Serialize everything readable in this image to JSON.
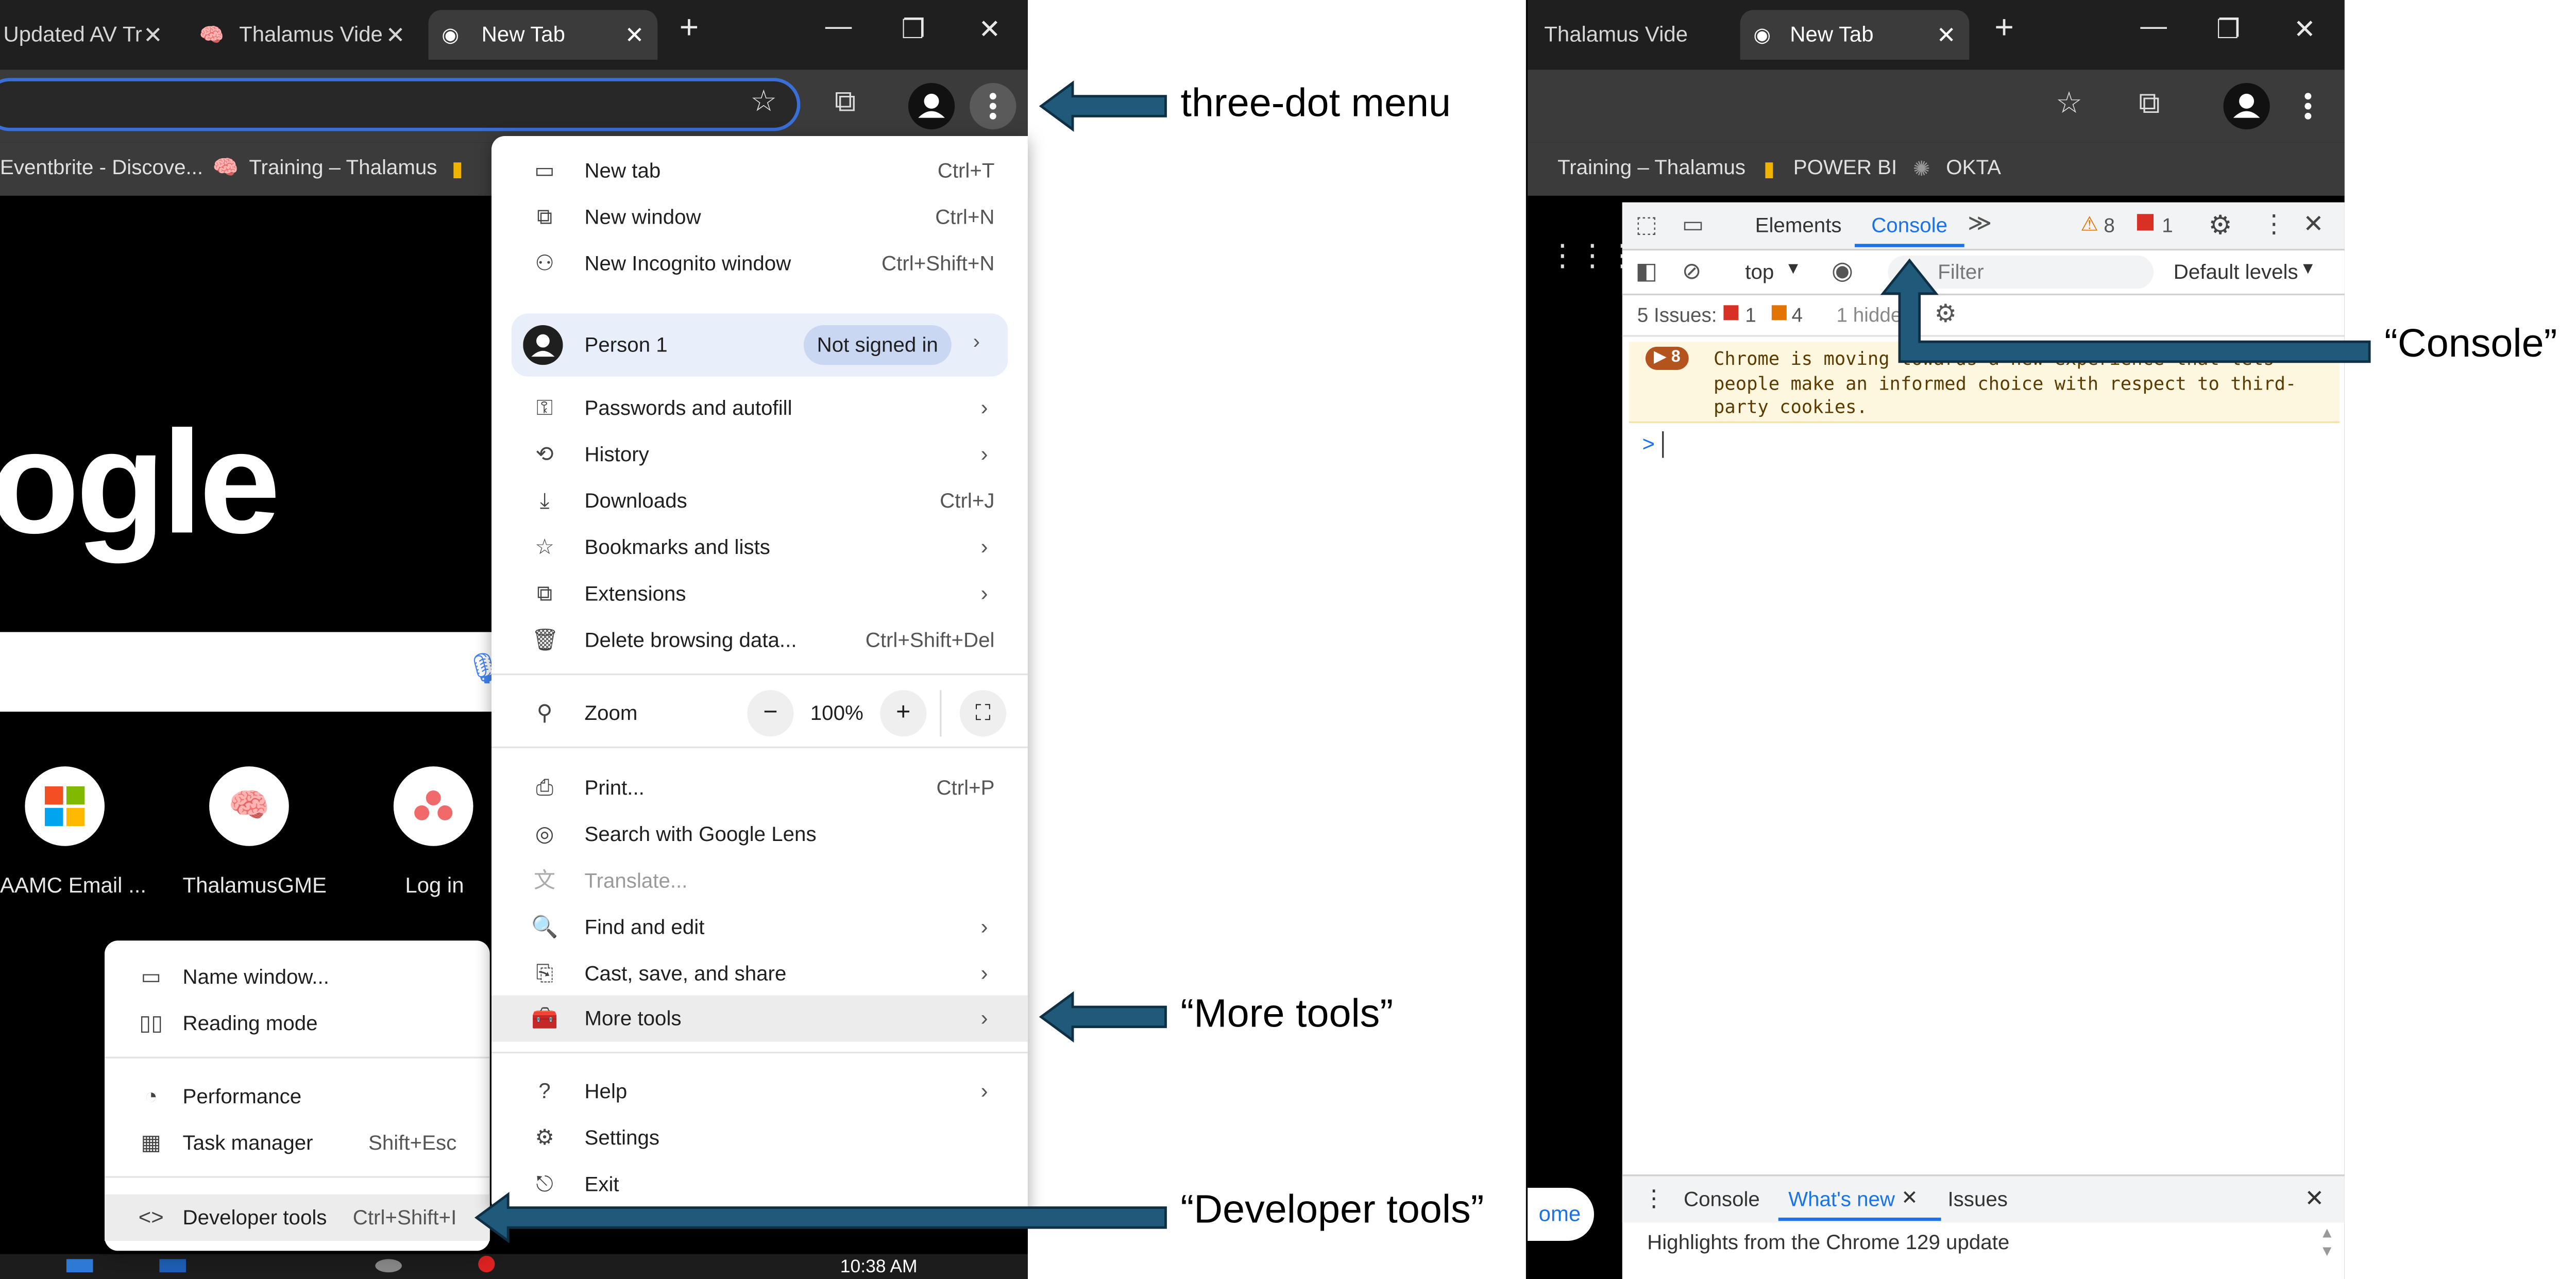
{
  "left_browser": {
    "tabs": [
      {
        "label": "Updated AV Tr",
        "icon": "globe-icon"
      },
      {
        "label": "Thalamus Vide",
        "icon": "brain-icon"
      },
      {
        "label": "New Tab",
        "icon": "chrome-icon",
        "active": true
      }
    ],
    "bookmarks": [
      "Eventbrite - Discove...",
      "Training – Thalamus"
    ],
    "logo_text": "ogle",
    "shortcuts": [
      {
        "label": "AAMC Email ...",
        "icon": "microsoft-icon"
      },
      {
        "label": "ThalamusGME",
        "icon": "brain-icon"
      },
      {
        "label": "Log in",
        "icon": "asana-icon"
      }
    ],
    "taskbar_time": "10:38 AM"
  },
  "chrome_menu": {
    "group1": [
      {
        "label": "New tab",
        "shortcut": "Ctrl+T",
        "icon": "new-tab-icon"
      },
      {
        "label": "New window",
        "shortcut": "Ctrl+N",
        "icon": "new-window-icon"
      },
      {
        "label": "New Incognito window",
        "shortcut": "Ctrl+Shift+N",
        "icon": "incognito-icon"
      }
    ],
    "profile": {
      "name": "Person 1",
      "status": "Not signed in"
    },
    "group2": [
      {
        "label": "Passwords and autofill",
        "icon": "key-icon",
        "arrow": true
      },
      {
        "label": "History",
        "icon": "history-icon",
        "arrow": true
      },
      {
        "label": "Downloads",
        "shortcut": "Ctrl+J",
        "icon": "download-icon"
      },
      {
        "label": "Bookmarks and lists",
        "icon": "star-icon",
        "arrow": true
      },
      {
        "label": "Extensions",
        "icon": "puzzle-icon",
        "arrow": true
      },
      {
        "label": "Delete browsing data...",
        "shortcut": "Ctrl+Shift+Del",
        "icon": "trash-icon"
      }
    ],
    "zoom": {
      "label": "Zoom",
      "value": "100%",
      "minus": "−",
      "plus": "+"
    },
    "group3": [
      {
        "label": "Print...",
        "shortcut": "Ctrl+P",
        "icon": "print-icon"
      },
      {
        "label": "Search with Google Lens",
        "icon": "lens-icon"
      },
      {
        "label": "Translate...",
        "icon": "translate-icon",
        "disabled": true
      },
      {
        "label": "Find and edit",
        "icon": "find-icon",
        "arrow": true
      },
      {
        "label": "Cast, save, and share",
        "icon": "cast-icon",
        "arrow": true
      },
      {
        "label": "More tools",
        "icon": "toolbox-icon",
        "arrow": true,
        "highlight": true
      }
    ],
    "group4": [
      {
        "label": "Help",
        "icon": "help-icon",
        "arrow": true
      },
      {
        "label": "Settings",
        "icon": "gear-icon"
      },
      {
        "label": "Exit",
        "icon": "exit-icon"
      }
    ]
  },
  "more_tools_menu": {
    "group1": [
      {
        "label": "Name window...",
        "icon": "window-icon"
      },
      {
        "label": "Reading mode",
        "icon": "book-icon"
      }
    ],
    "group2": [
      {
        "label": "Performance",
        "icon": "gauge-icon"
      },
      {
        "label": "Task manager",
        "shortcut": "Shift+Esc",
        "icon": "table-icon"
      }
    ],
    "group3": [
      {
        "label": "Developer tools",
        "shortcut": "Ctrl+Shift+I",
        "icon": "code-icon",
        "highlight": true
      }
    ]
  },
  "right_browser": {
    "tabs": [
      {
        "label": "Thalamus Vide",
        "icon": "brain-icon"
      },
      {
        "label": "New Tab",
        "icon": "chrome-icon",
        "active": true
      }
    ],
    "bookmarks": [
      "Training – Thalamus",
      "POWER BI",
      "OKTA"
    ],
    "partial_button": "ome"
  },
  "devtools": {
    "tabs": [
      "Elements",
      "Console"
    ],
    "active_tab": "Console",
    "warnings": "8",
    "errors": "1",
    "context": "top",
    "filter_placeholder": "Filter",
    "levels": "Default levels",
    "issues_label": "5 Issues:",
    "issues_errors": "1",
    "issues_warnings": "4",
    "hidden": "1 hidde",
    "message_count": "8",
    "message": "Chrome is moving towards a new experience that lets people make an informed choice with respect to third-party cookies.",
    "prompt": ">",
    "drawer_tabs": [
      "Console",
      "What's new",
      "Issues"
    ],
    "drawer_active": "What's new",
    "drawer_content": "Highlights from the Chrome 129 update"
  },
  "annotations": {
    "three_dot": "three-dot menu",
    "more_tools": "“More tools”",
    "developer_tools": "“Developer tools”",
    "console": "“Console”"
  },
  "colors": {
    "arrow_fill": "#1f5a7a",
    "arrow_stroke": "#0f2f44",
    "menu_highlight": "#ececec",
    "devtools_accent": "#1a73e8"
  }
}
